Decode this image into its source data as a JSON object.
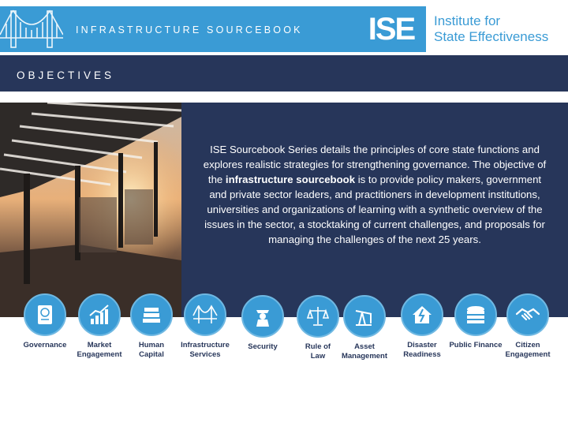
{
  "header": {
    "series_title": "INFRASTRUCTURE SOURCEBOOK",
    "logo_mark": "ISE",
    "logo_line1": "Institute for",
    "logo_line2": "State Effectiveness"
  },
  "section": {
    "title": "OBJECTIVES"
  },
  "body": {
    "text_before": "ISE Sourcebook Series details the principles of core state functions and explores realistic strategies for strengthening governance. The objective of the ",
    "text_bold": "infrastructure sourcebook",
    "text_after": " is to provide policy makers, government and private sector leaders, and practitioners in development institutions, universities and organizations of learning with a synthetic overview of the issues in the sector, a stocktaking of current challenges, and proposals for managing the challenges of the next 25 years."
  },
  "icons": [
    {
      "name": "governance-icon",
      "line1": "Governance",
      "line2": ""
    },
    {
      "name": "market-engagement-icon",
      "line1": "Market",
      "line2": "Engagement"
    },
    {
      "name": "human-capital-icon",
      "line1": "Human",
      "line2": "Capital"
    },
    {
      "name": "infrastructure-services-icon",
      "line1": "Infrastructure",
      "line2": "Services"
    },
    {
      "name": "security-icon",
      "line1": "Security",
      "line2": ""
    },
    {
      "name": "rule-of-law-icon",
      "line1": "Rule of",
      "line2": "Law"
    },
    {
      "name": "asset-management-icon",
      "line1": "Asset",
      "line2": "Management"
    },
    {
      "name": "disaster-readiness-icon",
      "line1": "Disaster",
      "line2": "Readiness"
    },
    {
      "name": "public-finance-icon",
      "line1": "Public Finance",
      "line2": ""
    },
    {
      "name": "citizen-engagement-icon",
      "line1": "Citizen",
      "line2": "Engagement"
    }
  ],
  "colors": {
    "accent_blue": "#3a9bd5",
    "navy": "#27365a"
  }
}
